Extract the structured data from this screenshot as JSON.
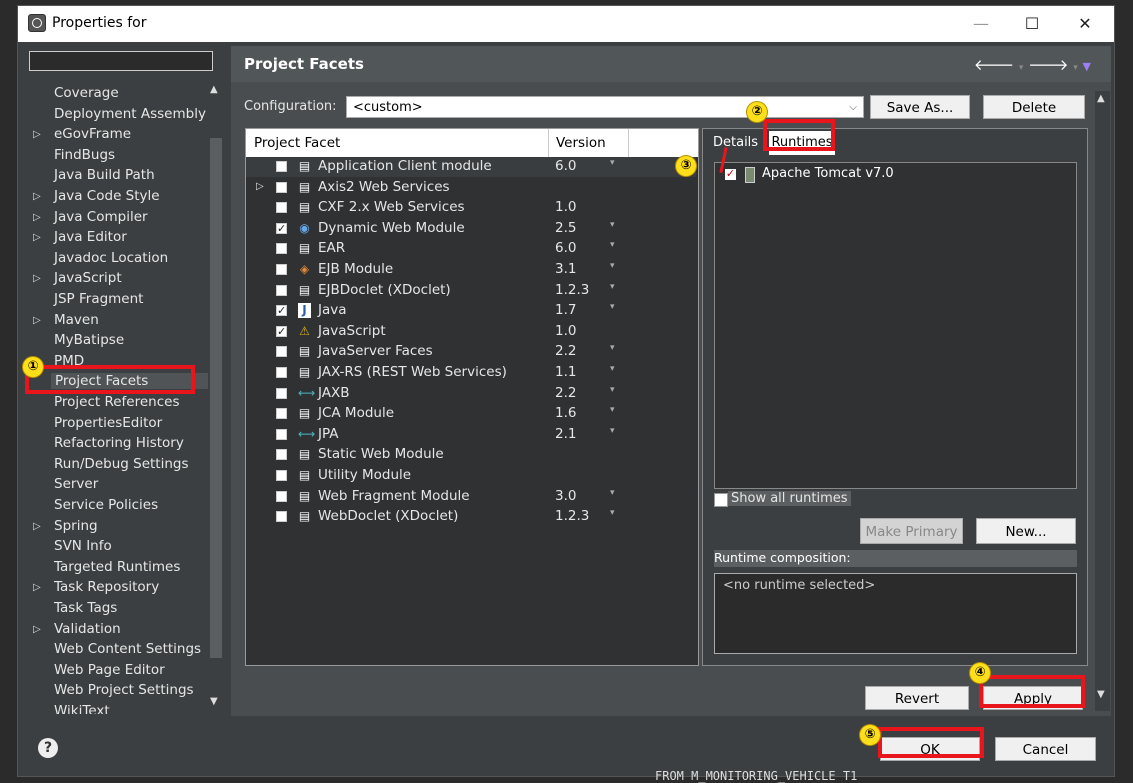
{
  "window": {
    "title": "Properties for",
    "min": "—",
    "max": "☐",
    "close": "✕"
  },
  "left": {
    "items": [
      {
        "label": "Coverage",
        "arrow": ""
      },
      {
        "label": "Deployment Assembly",
        "arrow": ""
      },
      {
        "label": "eGovFrame",
        "arrow": "▷"
      },
      {
        "label": "FindBugs",
        "arrow": ""
      },
      {
        "label": "Java Build Path",
        "arrow": ""
      },
      {
        "label": "Java Code Style",
        "arrow": "▷"
      },
      {
        "label": "Java Compiler",
        "arrow": "▷"
      },
      {
        "label": "Java Editor",
        "arrow": "▷"
      },
      {
        "label": "Javadoc Location",
        "arrow": ""
      },
      {
        "label": "JavaScript",
        "arrow": "▷"
      },
      {
        "label": "JSP Fragment",
        "arrow": ""
      },
      {
        "label": "Maven",
        "arrow": "▷"
      },
      {
        "label": "MyBatipse",
        "arrow": ""
      },
      {
        "label": "PMD",
        "arrow": ""
      },
      {
        "label": "Project Facets",
        "arrow": ""
      },
      {
        "label": "Project References",
        "arrow": ""
      },
      {
        "label": "PropertiesEditor",
        "arrow": ""
      },
      {
        "label": "Refactoring History",
        "arrow": ""
      },
      {
        "label": "Run/Debug Settings",
        "arrow": ""
      },
      {
        "label": "Server",
        "arrow": ""
      },
      {
        "label": "Service Policies",
        "arrow": ""
      },
      {
        "label": "Spring",
        "arrow": "▷"
      },
      {
        "label": "SVN Info",
        "arrow": ""
      },
      {
        "label": "Targeted Runtimes",
        "arrow": ""
      },
      {
        "label": "Task Repository",
        "arrow": "▷"
      },
      {
        "label": "Task Tags",
        "arrow": ""
      },
      {
        "label": "Validation",
        "arrow": "▷"
      },
      {
        "label": "Web Content Settings",
        "arrow": ""
      },
      {
        "label": "Web Page Editor",
        "arrow": ""
      },
      {
        "label": "Web Project Settings",
        "arrow": ""
      },
      {
        "label": "WikiText",
        "arrow": ""
      }
    ],
    "selected": "Project Facets"
  },
  "right": {
    "title": "Project Facets",
    "config_label": "Configuration:",
    "config_value": "<custom>",
    "save_as": "Save As...",
    "delete": "Delete",
    "col_facet": "Project Facet",
    "col_version": "Version",
    "facets": [
      {
        "name": "Application Client module",
        "version": "6.0",
        "checked": false,
        "icon": "doc",
        "exp": "",
        "dd": true
      },
      {
        "name": "Axis2 Web Services",
        "version": "",
        "checked": false,
        "icon": "doc",
        "exp": "▷",
        "dd": false
      },
      {
        "name": "CXF 2.x Web Services",
        "version": "1.0",
        "checked": false,
        "icon": "doc",
        "exp": "",
        "dd": false
      },
      {
        "name": "Dynamic Web Module",
        "version": "2.5",
        "checked": true,
        "icon": "web",
        "exp": "",
        "dd": true
      },
      {
        "name": "EAR",
        "version": "6.0",
        "checked": false,
        "icon": "doc",
        "exp": "",
        "dd": true
      },
      {
        "name": "EJB Module",
        "version": "3.1",
        "checked": false,
        "icon": "ejb",
        "exp": "",
        "dd": true
      },
      {
        "name": "EJBDoclet (XDoclet)",
        "version": "1.2.3",
        "checked": false,
        "icon": "doc",
        "exp": "",
        "dd": true
      },
      {
        "name": "Java",
        "version": "1.7",
        "checked": true,
        "icon": "java",
        "exp": "",
        "dd": true
      },
      {
        "name": "JavaScript",
        "version": "1.0",
        "checked": true,
        "icon": "js",
        "exp": "",
        "dd": false
      },
      {
        "name": "JavaServer Faces",
        "version": "2.2",
        "checked": false,
        "icon": "doc",
        "exp": "",
        "dd": true
      },
      {
        "name": "JAX-RS (REST Web Services)",
        "version": "1.1",
        "checked": false,
        "icon": "doc",
        "exp": "",
        "dd": true
      },
      {
        "name": "JAXB",
        "version": "2.2",
        "checked": false,
        "icon": "arrows",
        "exp": "",
        "dd": true
      },
      {
        "name": "JCA Module",
        "version": "1.6",
        "checked": false,
        "icon": "doc",
        "exp": "",
        "dd": true
      },
      {
        "name": "JPA",
        "version": "2.1",
        "checked": false,
        "icon": "arrows",
        "exp": "",
        "dd": true
      },
      {
        "name": "Static Web Module",
        "version": "",
        "checked": false,
        "icon": "doc",
        "exp": "",
        "dd": false
      },
      {
        "name": "Utility Module",
        "version": "",
        "checked": false,
        "icon": "doc",
        "exp": "",
        "dd": false
      },
      {
        "name": "Web Fragment Module",
        "version": "3.0",
        "checked": false,
        "icon": "doc",
        "exp": "",
        "dd": true
      },
      {
        "name": "WebDoclet (XDoclet)",
        "version": "1.2.3",
        "checked": false,
        "icon": "doc",
        "exp": "",
        "dd": true
      }
    ],
    "tab_details": "Details",
    "tab_runtimes": "Runtimes",
    "runtime_name": "Apache Tomcat v7.0",
    "show_all": "Show all runtimes",
    "make_primary": "Make Primary",
    "new": "New...",
    "composition_label": "Runtime composition:",
    "composition_value": "<no runtime selected>",
    "revert": "Revert",
    "apply": "Apply"
  },
  "bottom": {
    "help": "?",
    "ok": "OK",
    "cancel": "Cancel",
    "bg_code": "FROM M_MONITORING_VEHICLE T1"
  },
  "markers": [
    "①",
    "②",
    "③",
    "④",
    "⑤"
  ],
  "colors": {
    "highlight": "#e8161c",
    "marker": "#ffde1a"
  }
}
